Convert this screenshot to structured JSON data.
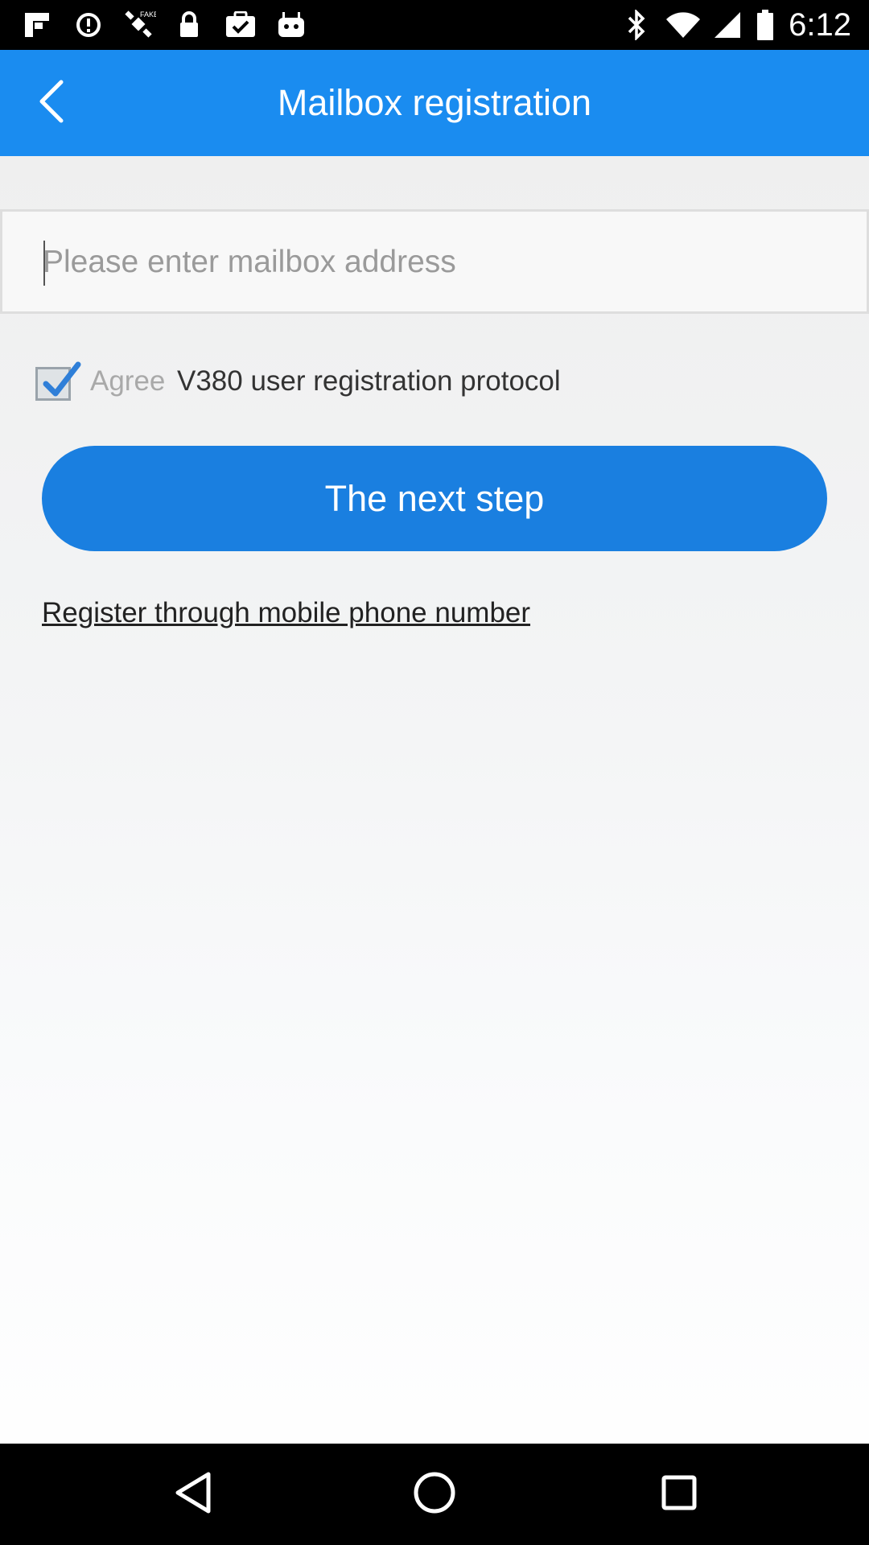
{
  "status_bar": {
    "time": "6:12",
    "left_icons": [
      "flipboard-icon",
      "data-saver-icon",
      "fake-gps-icon",
      "lock-icon",
      "task-icon",
      "android-icon"
    ],
    "right_icons": [
      "bluetooth-icon",
      "wifi-icon",
      "signal-icon",
      "battery-icon"
    ]
  },
  "app_bar": {
    "title": "Mailbox registration",
    "back_icon": "chevron-left-icon",
    "color": "#1a8cf0"
  },
  "form": {
    "email_placeholder": "Please enter mailbox address",
    "email_value": "",
    "agree_checked": true,
    "agree_label": "Agree",
    "protocol_link": "V380 user registration protocol",
    "next_button": "The next step",
    "alt_register_link": "Register through mobile phone number",
    "accent_color": "#1a7fe0"
  },
  "nav_bar": {
    "buttons": [
      "back-triangle-icon",
      "home-circle-icon",
      "recents-square-icon"
    ]
  }
}
